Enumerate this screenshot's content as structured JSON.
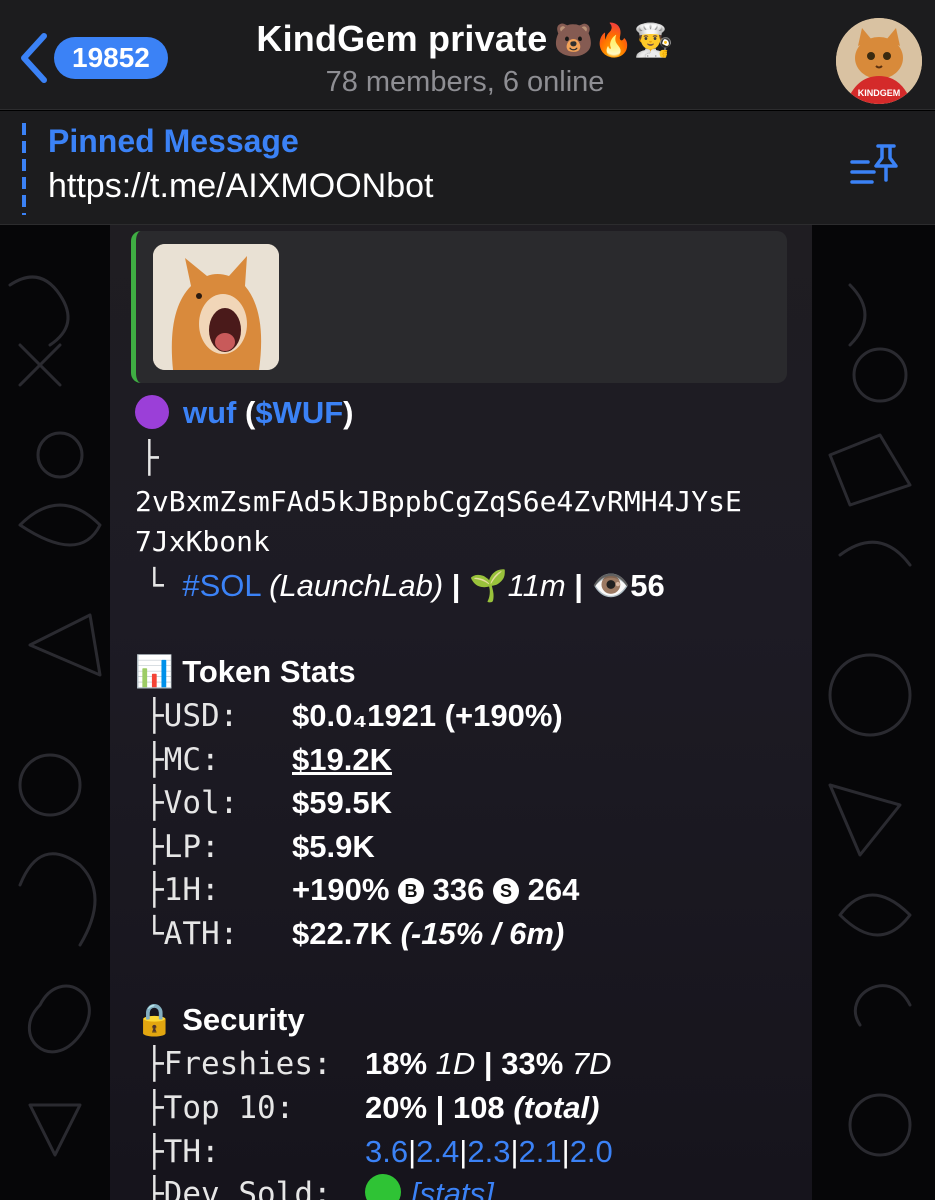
{
  "header": {
    "back_count": "19852",
    "title": "KindGem private",
    "title_emojis": "🐻🔥👨‍🍳",
    "subtitle": "78 members, 6 online",
    "avatar_label": "KINDGEM"
  },
  "pinned": {
    "title": "Pinned Message",
    "text": "https://t.me/AIXMOONbot"
  },
  "message": {
    "token_name": "wuf",
    "token_symbol": "$WUF",
    "address_line1": "2vBxmZsmFAd5kJBppbCgZqS6e4ZvRMH4JYsE",
    "address_line2": "7JxKbonk",
    "chain": "#SOL",
    "platform": "(LaunchLab)",
    "age": "11m",
    "views": "56",
    "token_stats_title": "Token Stats",
    "stats": {
      "usd_label": "USD:",
      "usd_value": "$0.0₄1921 (+190%)",
      "mc_label": "MC:",
      "mc_value": "$19.2K",
      "vol_label": "Vol:",
      "vol_value": "$59.5K",
      "lp_label": "LP:",
      "lp_value": "$5.9K",
      "h1_label": "1H:",
      "h1_change": "+190%",
      "h1_buys": "336",
      "h1_sells": "264",
      "ath_label": "ATH:",
      "ath_value": "$22.7K",
      "ath_detail": "(-15% / 6m)"
    },
    "security_title": "Security",
    "security": {
      "freshies_label": "Freshies:",
      "freshies_1d": "18%",
      "freshies_1d_unit": "1D",
      "freshies_7d": "33%",
      "freshies_7d_unit": "7D",
      "top10_label": "Top 10:",
      "top10_value": "20%",
      "top10_count": "108",
      "top10_unit": "(total)",
      "th_label": "TH:",
      "th_values": [
        "3.6",
        "2.4",
        "2.3",
        "2.1",
        "2.0"
      ],
      "dev_label": "Dev Sold:",
      "dev_link": "[stats]"
    }
  },
  "colors": {
    "accent": "#3b82f6",
    "preview_bar": "#3fae43",
    "header_bg": "#1c1c1e"
  }
}
